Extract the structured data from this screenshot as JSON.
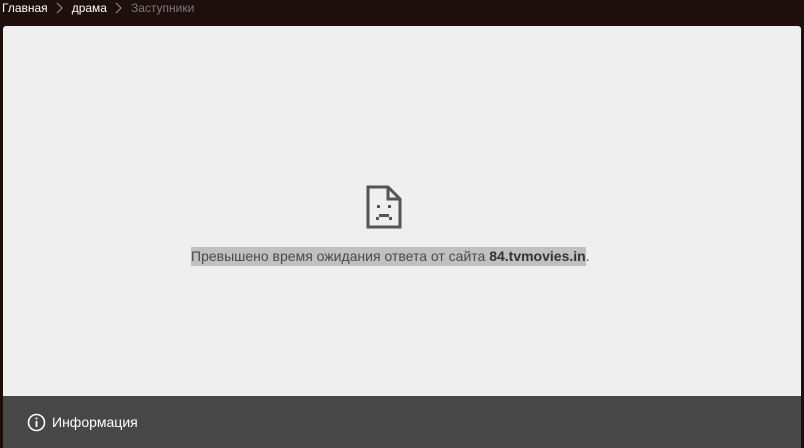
{
  "breadcrumb": {
    "items": [
      {
        "label": "Главная"
      },
      {
        "label": "драма"
      },
      {
        "label": "Заступники"
      }
    ]
  },
  "error": {
    "icon": "sad-page-icon",
    "message_prefix": "Превышено время ожидания ответа от сайта ",
    "host": "84.tvmovies.in",
    "message_suffix": "."
  },
  "infobar": {
    "icon": "info-icon",
    "label": "Информация"
  },
  "colors": {
    "topbar": "#1e0f0c",
    "frame": "#efefef",
    "infobar": "#474747",
    "highlight": "#c0c0c0"
  }
}
